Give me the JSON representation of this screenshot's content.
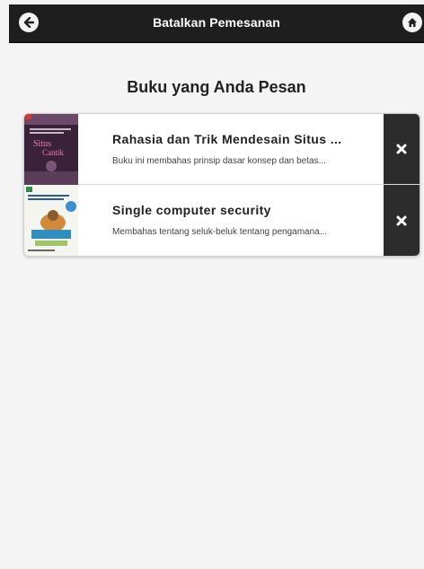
{
  "header": {
    "title": "Batalkan Pemesanan",
    "back_icon": "arrow-left-icon",
    "home_icon": "home-icon",
    "background": "#1e1e1e"
  },
  "page": {
    "title": "Buku yang Anda Pesan"
  },
  "orders": [
    {
      "title": "Rahasia dan Trik Mendesain Situs ...",
      "description": "Buku ini membahas prinsip dasar konsep dan betas...",
      "thumbnail_icon": "book-cover-situs-cantik",
      "delete_icon": "close-icon"
    },
    {
      "title": "Single computer security",
      "description": "Membahas tentang seluk-beluk tentang pengamana...",
      "thumbnail_icon": "book-cover-computer-security",
      "delete_icon": "close-icon"
    }
  ]
}
